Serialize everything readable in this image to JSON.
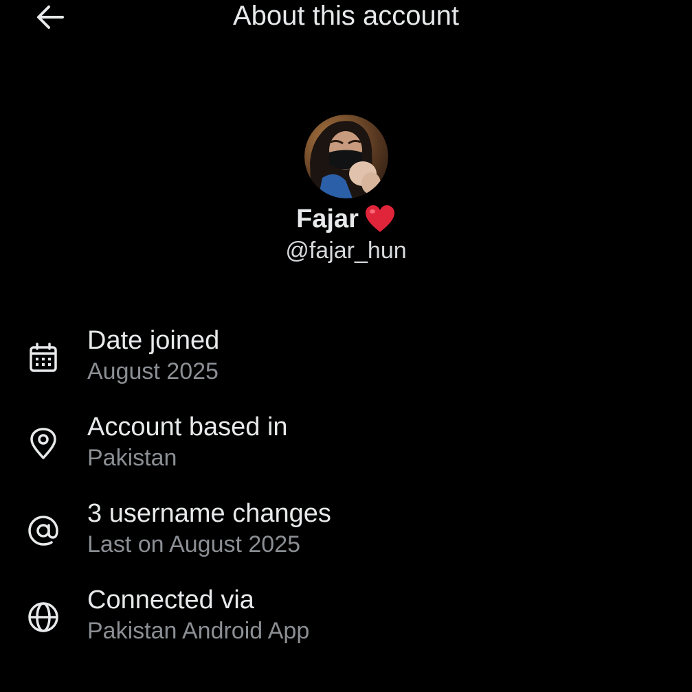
{
  "header": {
    "title": "About this account",
    "back_icon": "arrow-left-icon"
  },
  "profile": {
    "display_name": "Fajar",
    "name_emoji": "heart-icon",
    "handle": "@fajar_hun"
  },
  "info": [
    {
      "icon": "calendar-icon",
      "title": "Date joined",
      "subtitle": "August 2025"
    },
    {
      "icon": "location-pin-icon",
      "title": "Account based in",
      "subtitle": "Pakistan"
    },
    {
      "icon": "at-sign-icon",
      "title": "3 username changes",
      "subtitle": "Last on August 2025"
    },
    {
      "icon": "globe-icon",
      "title": "Connected via",
      "subtitle": "Pakistan Android App"
    }
  ],
  "colors": {
    "background": "#000000",
    "primary_text": "#e7e9ea",
    "secondary_text": "#8b8f94",
    "heart": "#e0243a"
  }
}
